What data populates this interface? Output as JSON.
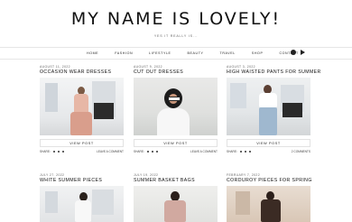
{
  "site": {
    "title": "MY NAME IS LOVELY!",
    "tagline": "YES IT REALLY IS..."
  },
  "nav": {
    "items": [
      "HOME",
      "FASHION",
      "LIFESTYLE",
      "BEAUTY",
      "TRAVEL",
      "SHOP",
      "CONTACT"
    ]
  },
  "posts": [
    {
      "date": "AUGUST 11, 2022",
      "title": "OCCASION WEAR DRESSES",
      "button": "VIEW POST",
      "share": "SHARE:",
      "comments": "LEAVE A COMMENT"
    },
    {
      "date": "AUGUST 9, 2022",
      "title": "CUT OUT DRESSES",
      "button": "VIEW POST",
      "share": "SHARE:",
      "comments": "LEAVE A COMMENT"
    },
    {
      "date": "AUGUST 3, 2022",
      "title": "HIGH WAISTED PANTS FOR SUMMER",
      "button": "VIEW POST",
      "share": "SHARE:",
      "comments": "2 COMMENTS"
    },
    {
      "date": "JULY 27, 2022",
      "title": "WHITE SUMMER PIECES"
    },
    {
      "date": "JULY 19, 2022",
      "title": "SUMMER BASKET BAGS"
    },
    {
      "date": "FEBRUARY 7, 2022",
      "title": "CORDUROY PIECES FOR SPRING"
    }
  ],
  "colors": {
    "text": "#111111",
    "muted": "#666666",
    "border": "#e6e6e6"
  }
}
